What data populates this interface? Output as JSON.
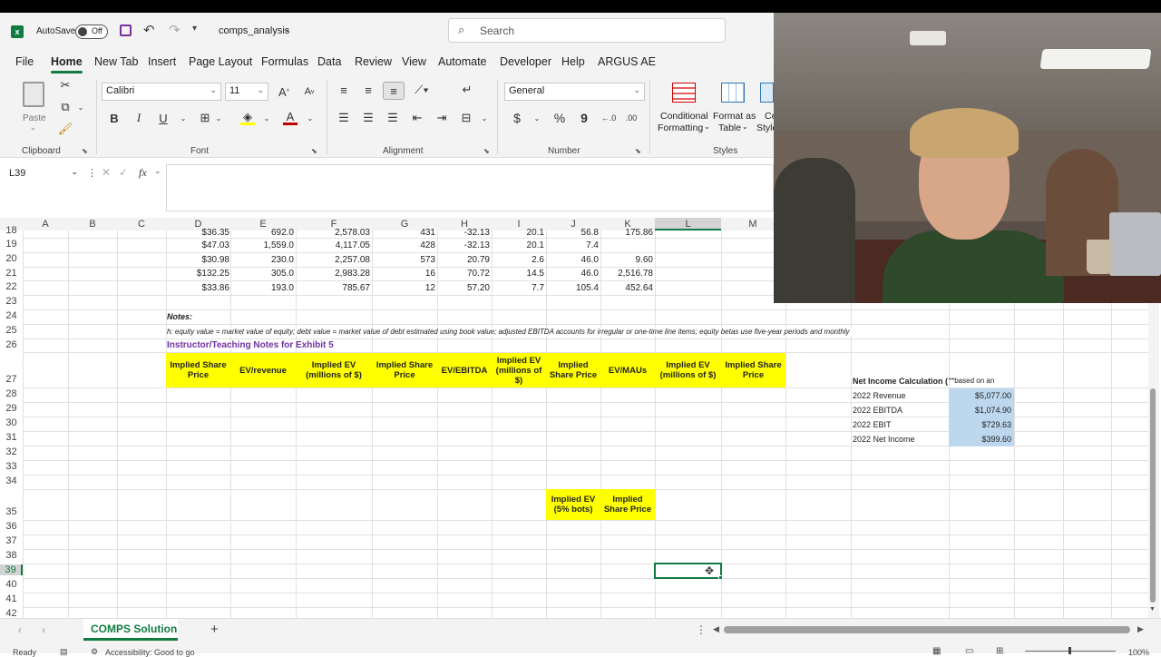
{
  "titlebar": {
    "autosave_label": "AutoSave",
    "autosave_state": "Off",
    "filename": "comps_analysis",
    "search_placeholder": "Search"
  },
  "tabs": [
    "File",
    "Home",
    "New Tab",
    "Insert",
    "Page Layout",
    "Formulas",
    "Data",
    "Review",
    "View",
    "Automate",
    "Developer",
    "Help",
    "ARGUS AE"
  ],
  "ribbon": {
    "paste_label": "Paste",
    "clipboard_label": "Clipboard",
    "font_name": "Calibri",
    "font_size": "11",
    "font_label": "Font",
    "bold": "B",
    "italic": "I",
    "underline": "U",
    "alignment_label": "Alignment",
    "number_format": "General",
    "number_label": "Number",
    "currency_symbol": "$",
    "percent_symbol": "%",
    "comma_symbol": "9",
    "conditional_formatting_1": "Conditional",
    "conditional_formatting_2": "Formatting",
    "format_table_1": "Format as",
    "format_table_2": "Table",
    "cell_styles_1": "Ce",
    "cell_styles_2": "Style",
    "styles_label": "Styles"
  },
  "formula_bar": {
    "name_box": "L39",
    "fx": "fx",
    "content": ""
  },
  "columns": [
    "A",
    "B",
    "C",
    "D",
    "E",
    "F",
    "G",
    "H",
    "I",
    "J",
    "K",
    "L",
    "M"
  ],
  "rows": [
    "18",
    "19",
    "20",
    "21",
    "22",
    "23",
    "24",
    "25",
    "26",
    "27",
    "28",
    "29",
    "30",
    "31",
    "32",
    "33",
    "34",
    "35",
    "36",
    "37",
    "38",
    "39",
    "40",
    "41",
    "42"
  ],
  "data_rows": [
    {
      "d": "$36.35",
      "e": "692.0",
      "f": "2,578.03",
      "g": "431",
      "h": "-32.13",
      "i": "20.1",
      "j": "56.8",
      "k": "175.86"
    },
    {
      "d": "$47.03",
      "e": "1,559.0",
      "f": "4,117.05",
      "g": "428",
      "h": "-32.13",
      "i": "20.1",
      "j": "7.4",
      "k": ""
    },
    {
      "d": "$30.98",
      "e": "230.0",
      "f": "2,257.08",
      "g": "573",
      "h": "20.79",
      "i": "2.6",
      "j": "46.0",
      "k": "9.60"
    },
    {
      "d": "$132.25",
      "e": "305.0",
      "f": "2,983.28",
      "g": "16",
      "h": "70.72",
      "i": "14.5",
      "j": "46.0",
      "k": "2,516.78"
    },
    {
      "d": "$33.86",
      "e": "193.0",
      "f": "785.67",
      "g": "12",
      "h": "57.20",
      "i": "7.7",
      "j": "105.4",
      "k": "452.64"
    }
  ],
  "notes": {
    "heading": "Notes:",
    "text": "h: equity value = market value of equity; debt value = market value of debt estimated using book value; adjusted EBITDA accounts for irregular or one-time line items; equity betas use five-year periods and monthly",
    "instructor": "Instructor/Teaching Notes for Exhibit 5"
  },
  "yellow_headers": [
    "Implied Share Price",
    "EV/revenue",
    "Implied EV (millions of $)",
    "Implied Share Price",
    "EV/EBITDA",
    "Implied EV (millions of $)",
    "Implied Share Price",
    "EV/MAUs",
    "Implied EV (millions of $)",
    "Implied Share Price"
  ],
  "yellow_headers_2": [
    "Implied EV (5% bots)",
    "Implied Share Price"
  ],
  "net_income": {
    "title": "Net Income Calculation (",
    "title_note": "**based on an",
    "items": [
      {
        "label": "2022 Revenue",
        "value": "$5,077.00"
      },
      {
        "label": "2022 EBITDA",
        "value": "$1,074.90"
      },
      {
        "label": "2022 EBIT",
        "value": "$729.63"
      },
      {
        "label": "2022 Net Income",
        "value": "$399.60"
      }
    ]
  },
  "sheet_tab": "COMPS Solution",
  "status": {
    "ready": "Ready",
    "accessibility": "Accessibility: Good to go",
    "zoom": "100%"
  },
  "colors": {
    "excel_green": "#107c41",
    "highlight_yellow": "#ffff00",
    "input_blue": "#bdd7ee",
    "purple_text": "#7030a0"
  }
}
